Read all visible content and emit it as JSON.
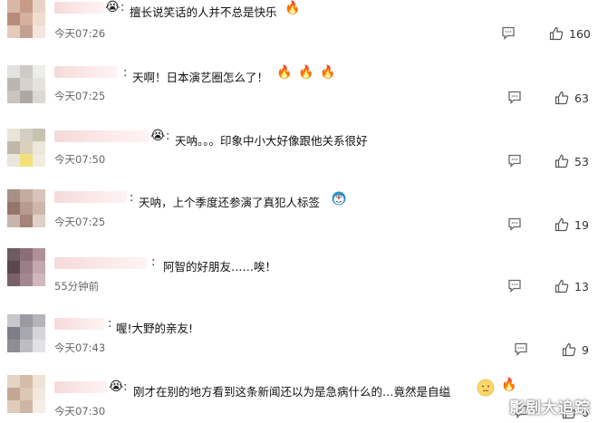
{
  "comments": [
    {
      "text": "擅长说笑话的人并不总是快乐",
      "time": "今天07:26",
      "likes": "160"
    },
    {
      "text": "天啊！日本演艺圈怎么了！",
      "time": "今天07:25",
      "likes": "63"
    },
    {
      "text": "天呐。。。印象中小大好像跟他关系很好",
      "time": "今天07:50",
      "likes": "53"
    },
    {
      "text": "天呐，上个季度还参演了真犯人标签",
      "time": "今天07:25",
      "likes": "19"
    },
    {
      "text": "阿智的好朋友……唉！",
      "time": "55分钟前",
      "likes": "13"
    },
    {
      "text": "喔!大野的亲友!",
      "time": "今天07:43",
      "likes": "9"
    },
    {
      "text": "刚才在别的地方看到这条新闻还以为是急病什么的…竟然是自缢",
      "time": "今天07:30",
      "likes": "6"
    }
  ],
  "colon": ":",
  "icons": {
    "comment": "comment-icon",
    "like": "thumbs-up-icon",
    "emoji_fire": "fire-emoji",
    "emoji_cry": "crying-emoji",
    "emoji_doraemon": "doraemon-emoji",
    "emoji_sad": "sad-face-emoji"
  },
  "watermark": "影剧大追踪"
}
